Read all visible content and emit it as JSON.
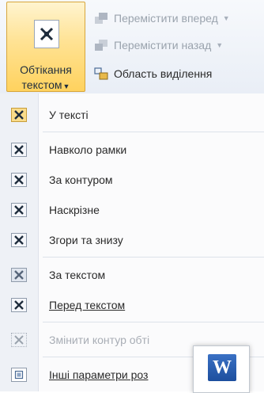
{
  "ribbon": {
    "wrap_text_button": {
      "line1": "Обтікання",
      "line2": "текстом",
      "caret": "▼"
    },
    "bring_forward": {
      "label": "Перемістити вперед",
      "dropdown": "▼"
    },
    "send_backward": {
      "label": "Перемістити назад",
      "dropdown": "▼"
    },
    "selection_pane": {
      "label": "Область виділення"
    }
  },
  "menu": {
    "items": [
      {
        "label": "У тексті",
        "selected": true
      },
      {
        "label": "Навколо рамки"
      },
      {
        "label": "За контуром"
      },
      {
        "label": "Наскрізне"
      },
      {
        "label": "Згори та знизу"
      },
      {
        "label": "За текстом"
      },
      {
        "label": "Перед текстом"
      },
      {
        "label": "Змінити контур обті",
        "disabled": true
      },
      {
        "label": "Інші параметри роз"
      }
    ]
  },
  "app_logo": {
    "letter": "W",
    "color": "#2b5ea9"
  },
  "colors": {
    "highlight": "#ffd25e",
    "gutter": "#eef1f6"
  }
}
